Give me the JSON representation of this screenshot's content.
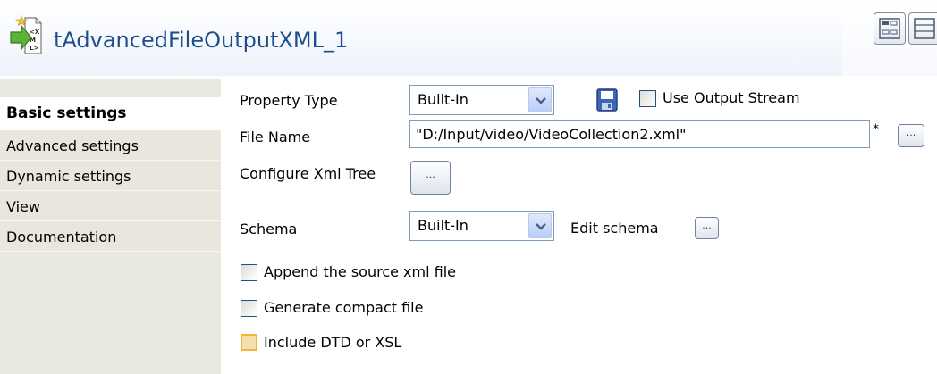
{
  "header": {
    "title": "tAdvancedFileOutputXML_1",
    "icon": "xml-file-output-icon",
    "buttons": [
      "layout-grid-icon",
      "layout-rows-icon"
    ]
  },
  "tabs": [
    {
      "label": "Basic settings",
      "active": true
    },
    {
      "label": "Advanced settings",
      "active": false
    },
    {
      "label": "Dynamic settings",
      "active": false
    },
    {
      "label": "View",
      "active": false
    },
    {
      "label": "Documentation",
      "active": false
    }
  ],
  "form": {
    "property_type_label": "Property Type",
    "property_type_value": "Built-In",
    "use_output_stream_label": "Use Output Stream",
    "file_name_label": "File Name",
    "file_name_value": "\"D:/Input/video/VideoCollection2.xml\"",
    "required_mark": "*",
    "configure_tree_label": "Configure Xml Tree",
    "schema_label": "Schema",
    "schema_value": "Built-In",
    "edit_schema_label": "Edit schema",
    "ellipsis": "...",
    "append_label": "Append the source xml file",
    "compact_label": "Generate compact file",
    "dtd_label": "Include DTD or XSL"
  },
  "colors": {
    "title": "#1f4f8a",
    "tab_background": "#eae9e1",
    "header_gradient_end": "#eef3fb",
    "checkbox_focus": "#f5b13e"
  }
}
